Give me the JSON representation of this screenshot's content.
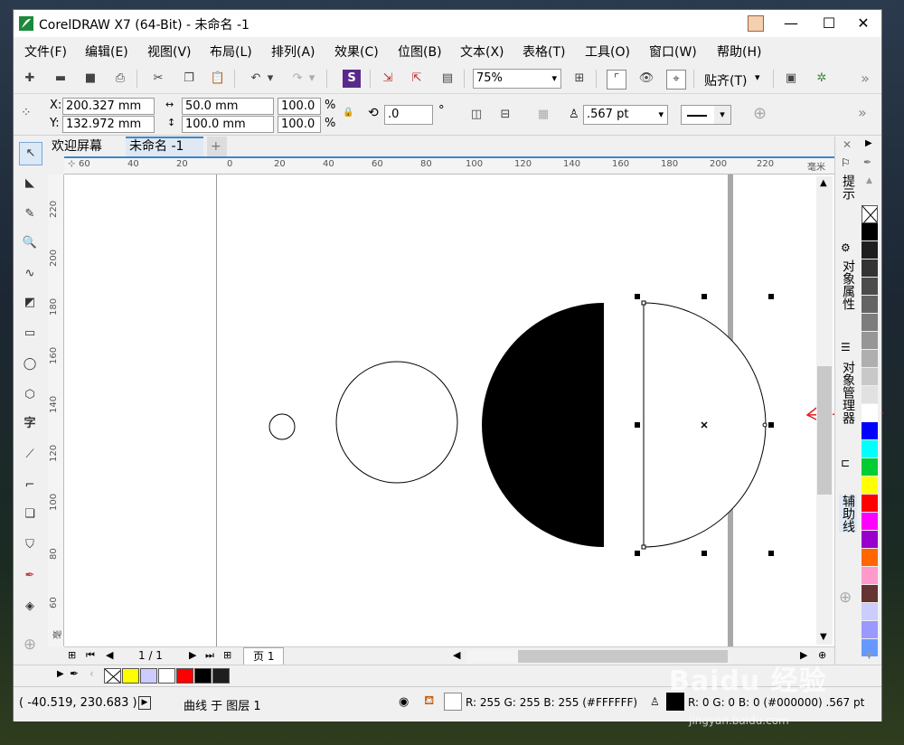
{
  "title": "CorelDRAW X7 (64-Bit) - 未命名 -1",
  "window_controls": {
    "minimize": "—",
    "maximize": "☐",
    "close": "✕"
  },
  "menu": [
    "文件(F)",
    "编辑(E)",
    "视图(V)",
    "布局(L)",
    "排列(A)",
    "效果(C)",
    "位图(B)",
    "文本(X)",
    "表格(T)",
    "工具(O)",
    "窗口(W)",
    "帮助(H)"
  ],
  "toolbar": {
    "zoom": "75%",
    "snap": "贴齐(T)",
    "more": "»"
  },
  "properties": {
    "x_label": "X:",
    "x": "200.327 mm",
    "y_label": "Y:",
    "y": "132.972 mm",
    "width": "50.0 mm",
    "height": "100.0 mm",
    "scale_x": "100.0",
    "scale_y": "100.0",
    "percent": "%",
    "rotation": ".0",
    "degree": "°",
    "outline_width": ".567 pt"
  },
  "tabs": {
    "welcome": "欢迎屏幕",
    "document": "未命名 -1",
    "add": "+"
  },
  "ruler": {
    "unit": "毫米",
    "top_ticks": [
      "60",
      "40",
      "20",
      "0",
      "20",
      "40",
      "60",
      "80",
      "100",
      "120",
      "140",
      "160",
      "180",
      "200",
      "220"
    ],
    "left_ticks": [
      "220",
      "200",
      "180",
      "160",
      "140",
      "120",
      "100",
      "80",
      "60"
    ]
  },
  "docker": {
    "hints": "提示",
    "properties": "对象属性",
    "manager": "对象管理器",
    "guides": "辅助线"
  },
  "page_nav": {
    "count": "1 / 1",
    "page_tab": "页 1"
  },
  "status": {
    "coords": "( -40.519, 230.683 )",
    "selection": "曲线 于 图层 1",
    "fill": "R: 255 G: 255 B: 255 (#FFFFFF)",
    "outline": "R: 0 G: 0 B: 0 (#000000)  .567 pt"
  },
  "palette_colors": [
    "#000000",
    "#1e1e1e",
    "#333333",
    "#4b4b4b",
    "#646464",
    "#7d7d7d",
    "#969696",
    "#afafaf",
    "#c8c8c8",
    "#e1e1e1",
    "#ffffff",
    "#0000ff",
    "#00ffff",
    "#00cc33",
    "#ffff00",
    "#ff0000",
    "#ff00ff",
    "#9900cc",
    "#ff6600",
    "#ff99cc",
    "#663333",
    "#ccccff",
    "#9999ff",
    "#6699ff"
  ],
  "doc_palette_colors": [
    "#ffff00",
    "#ccccff",
    "#ffffff",
    "#ff0000",
    "#000000",
    "#1e1e1e"
  ],
  "watermark": {
    "main": "Baidu 经验",
    "sub": "jingyan.baidu.com"
  }
}
